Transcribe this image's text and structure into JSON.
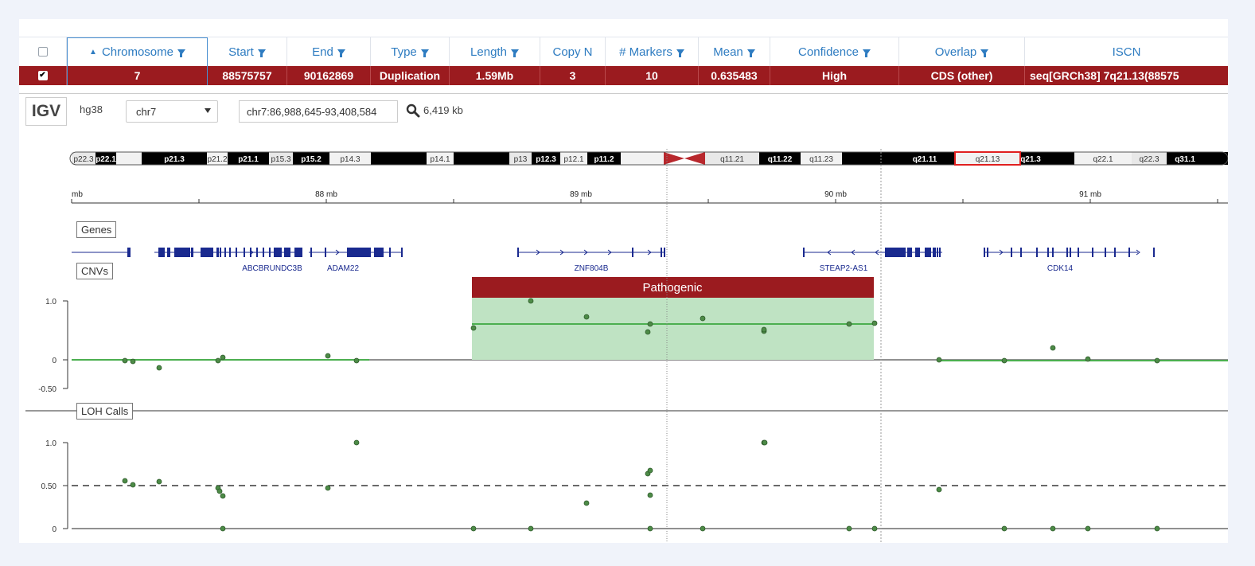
{
  "grid": {
    "headers": [
      {
        "label": "Chromosome",
        "sorted": true
      },
      {
        "label": "Start"
      },
      {
        "label": "End"
      },
      {
        "label": "Type"
      },
      {
        "label": "Length"
      },
      {
        "label": "Copy N"
      },
      {
        "label": "# Markers"
      },
      {
        "label": "Mean"
      },
      {
        "label": "Confidence"
      },
      {
        "label": "Overlap"
      },
      {
        "label": "ISCN"
      }
    ],
    "row": {
      "checked": true,
      "cells": [
        "7",
        "88575757",
        "90162869",
        "Duplication",
        "1.59Mb",
        "3",
        "10",
        "0.635483",
        "High",
        "CDS (other)",
        "seq[GRCh38] 7q21.13(88575"
      ]
    }
  },
  "igv": {
    "logo": "IGV",
    "genome": "hg38",
    "chromosome": "chr7",
    "locus": "chr7:86,988,645-93,408,584",
    "span": "6,419 kb",
    "ideogram": [
      "p22.3",
      "p22.1",
      "p21.3",
      "p21.2",
      "p21.1",
      "p15.3",
      "p15.2",
      "p14.3",
      "p14.1",
      "p13",
      "p12.3",
      "p12.1",
      "p11.2",
      "q11.21",
      "q11.22",
      "q11.23",
      "q21.11",
      "q21.13",
      "q21.3",
      "q22.1",
      "q22.3",
      "q31.1"
    ],
    "ruler_labels": [
      "mb",
      "88 mb",
      "89 mb",
      "90 mb",
      "91 mb"
    ],
    "tracks": {
      "genes": {
        "label": "Genes",
        "gene_names": [
          "ABCB1",
          "RUNDC3B",
          "ADAM22",
          "ZNF804B",
          "STEAP2-AS1",
          "CDK14"
        ],
        "overlapping_label_text": [
          "ABCBRUNDC3B",
          "ADAM22"
        ]
      },
      "cnvs": {
        "label": "CNVs",
        "segment_label": "Pathogenic",
        "y_ticks": [
          "1.0",
          "0",
          "-0.50"
        ]
      },
      "loh": {
        "label": "LOH Calls",
        "y_ticks": [
          "1.0",
          "0.50",
          "0"
        ]
      }
    },
    "colors": {
      "row_selected": "#9b1b1f",
      "header_text": "#2e7cc1",
      "gene": "#1a2a8f",
      "cnv_segment": "#bfe3c3",
      "cnv_line": "#4caf50",
      "point": "#4d8b47"
    }
  }
}
